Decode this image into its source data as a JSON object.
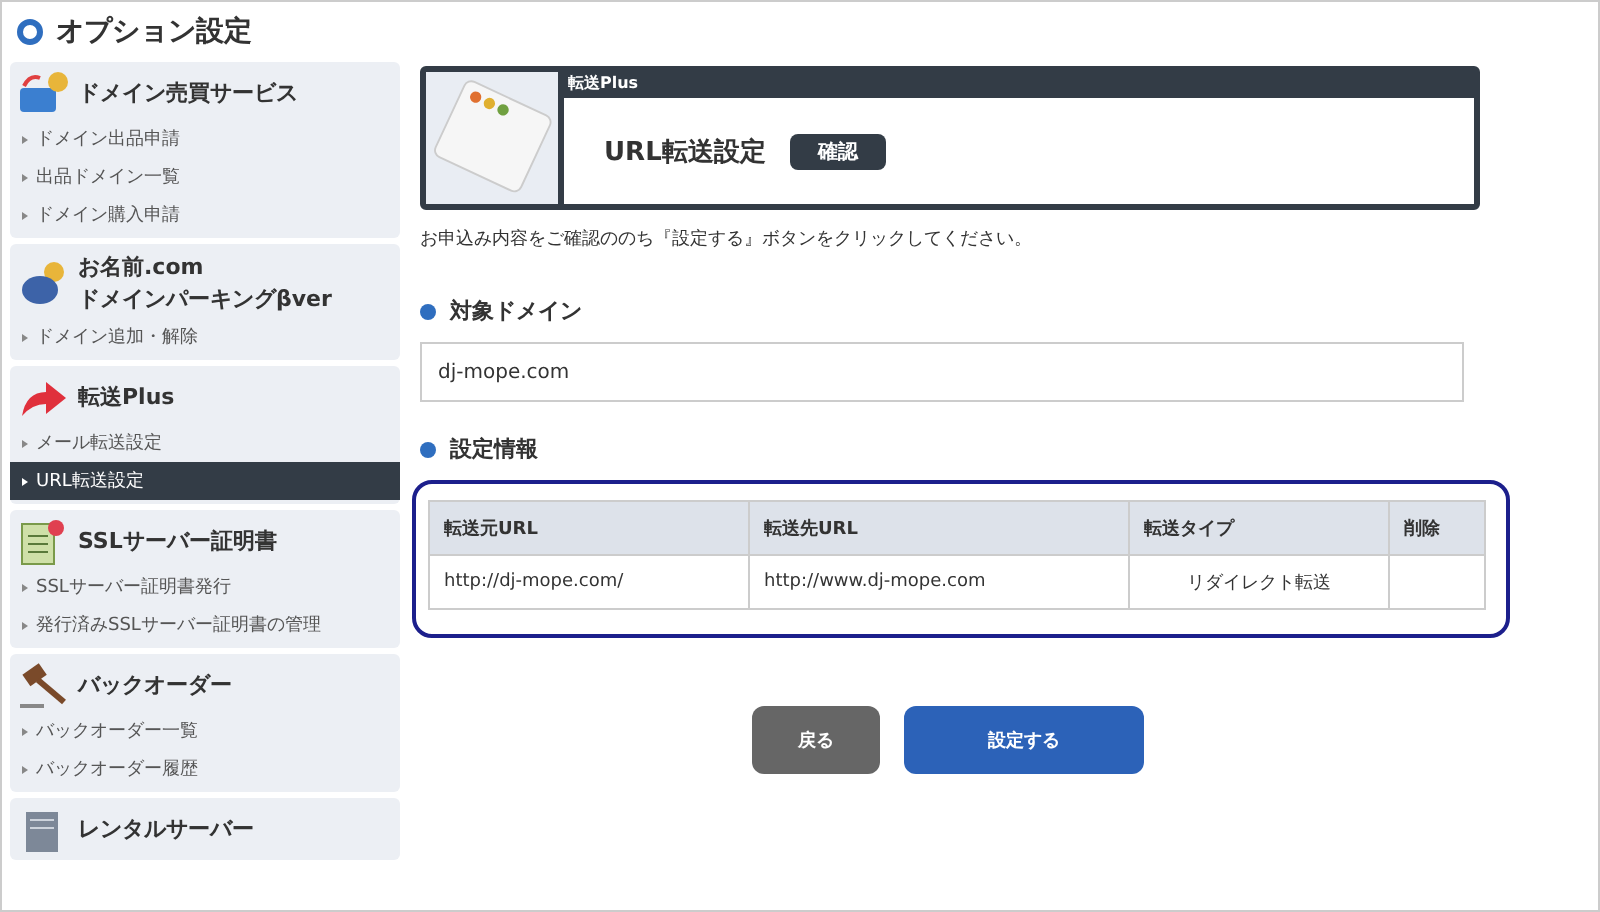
{
  "page_title": "オプション設定",
  "sidebar": [
    {
      "title": "ドメイン売買サービス",
      "items": [
        {
          "label": "ドメイン出品申請",
          "selected": false
        },
        {
          "label": "出品ドメイン一覧",
          "selected": false
        },
        {
          "label": "ドメイン購入申請",
          "selected": false
        }
      ]
    },
    {
      "title": "お名前.com",
      "subtitle": "ドメインパーキングβver",
      "items": [
        {
          "label": "ドメイン追加・解除",
          "selected": false
        }
      ]
    },
    {
      "title": "転送Plus",
      "items": [
        {
          "label": "メール転送設定",
          "selected": false
        },
        {
          "label": "URL転送設定",
          "selected": true
        }
      ]
    },
    {
      "title": "SSLサーバー証明書",
      "items": [
        {
          "label": "SSLサーバー証明書発行",
          "selected": false
        },
        {
          "label": "発行済みSSLサーバー証明書の管理",
          "selected": false
        }
      ]
    },
    {
      "title": "バックオーダー",
      "items": [
        {
          "label": "バックオーダー一覧",
          "selected": false
        },
        {
          "label": "バックオーダー履歴",
          "selected": false
        }
      ]
    },
    {
      "title": "レンタルサーバー"
    }
  ],
  "header": {
    "tab": "転送Plus",
    "title": "URL転送設定",
    "badge": "確認"
  },
  "instruction": "お申込み内容をご確認ののち『設定する』ボタンをクリックしてください。",
  "target_domain": {
    "heading": "対象ドメイン",
    "value": "dj-mope.com"
  },
  "settings": {
    "heading": "設定情報",
    "columns": [
      "転送元URL",
      "転送先URL",
      "転送タイプ",
      "削除"
    ],
    "rows": [
      [
        "http://dj-mope.com/",
        "http://www.dj-mope.com",
        "リダイレクト転送",
        ""
      ]
    ]
  },
  "buttons": [
    {
      "kind": "back",
      "label": "戻る"
    },
    {
      "kind": "submit",
      "label": "設定する"
    }
  ]
}
